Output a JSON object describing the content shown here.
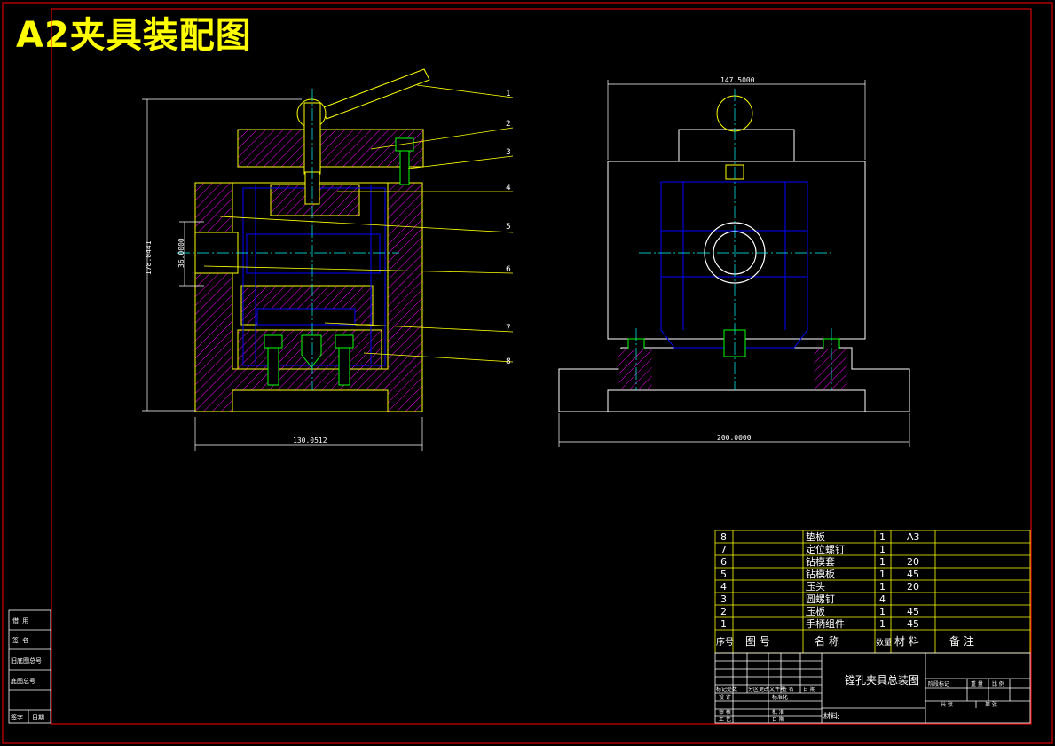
{
  "title": "A2夹具装配图",
  "colors": {
    "background": "#000000",
    "frame": "#ff0000",
    "outline": "#ffff00",
    "hatch": "#ff00ff",
    "hidden": "#0000ff",
    "center": "#00ffff",
    "bolt": "#00ff00",
    "white": "#ffffff"
  },
  "dimensions": {
    "front_width": "130.0512",
    "front_height": "178.0441",
    "bore": "36.0000",
    "side_top": "147.5000",
    "side_bottom": "200.0000"
  },
  "balloons": [
    "1",
    "2",
    "3",
    "4",
    "5",
    "6",
    "7",
    "8"
  ],
  "bom_rows": [
    {
      "no": "8",
      "name": "垫板",
      "qty": "1",
      "mat": "A3"
    },
    {
      "no": "7",
      "name": "定位螺钉",
      "qty": "1",
      "mat": ""
    },
    {
      "no": "6",
      "name": "钻模套",
      "qty": "1",
      "mat": "20"
    },
    {
      "no": "5",
      "name": "钻模板",
      "qty": "1",
      "mat": "45"
    },
    {
      "no": "4",
      "name": "压头",
      "qty": "1",
      "mat": "20"
    },
    {
      "no": "3",
      "name": "圆螺钉",
      "qty": "4",
      "mat": ""
    },
    {
      "no": "2",
      "name": "压板",
      "qty": "1",
      "mat": "45"
    },
    {
      "no": "1",
      "name": "手柄组件",
      "qty": "1",
      "mat": "45"
    }
  ],
  "bom_header": {
    "no": "序号",
    "drawing": "图 号",
    "name": "名 称",
    "qty": "数量",
    "mat": "材 料",
    "note": "备 注"
  },
  "title_block": {
    "drawing_name": "镗孔夹具总装图",
    "material_label": "材料:",
    "c_r1": "标记处数",
    "c_r2": "分区更改文件号",
    "c_r3": "签 名",
    "c_r4": "日 期",
    "c_r5": "设 计",
    "c_r6": "标准化",
    "c_r7": "审 核",
    "c_r8": "批 准",
    "c_r9": "工 艺",
    "c_r10": "日 期",
    "st_label": "阶段标记",
    "weight_label": "重 量",
    "scale_label": "比 例",
    "sheet_total": "共 张",
    "sheet_no": "第 张"
  },
  "side_strip": [
    "借 用",
    "签 名",
    "旧底图总号",
    "底图总号",
    "签字",
    "日期"
  ]
}
